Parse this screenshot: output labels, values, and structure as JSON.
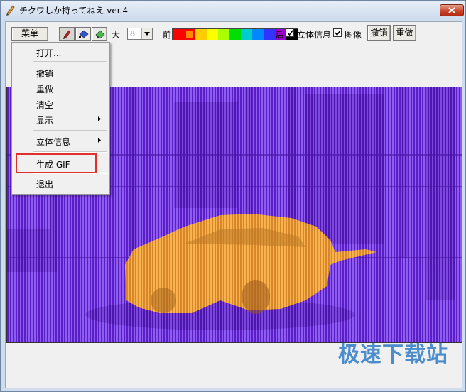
{
  "window": {
    "title": "チクワしか持ってねえ ver.4"
  },
  "toolbar": {
    "menu_label": "菜单",
    "size_label": "大",
    "size_value": "8",
    "front_label": "前",
    "back_label": "后",
    "stereo_label": "立体信息",
    "image_label": "图像",
    "undo_label": "撤销",
    "redo_label": "重做",
    "stereo_checked": true,
    "image_checked": true,
    "palette": [
      "#ff0000",
      "#ff8800",
      "#ffcc00",
      "#ffff00",
      "#aaff00",
      "#00dd00",
      "#00cccc",
      "#0088ff",
      "#3333ff",
      "#9900cc",
      "#000000"
    ]
  },
  "menu": {
    "items": [
      {
        "label": "打开..."
      },
      {
        "label": "撤销"
      },
      {
        "label": "重做"
      },
      {
        "label": "清空"
      },
      {
        "label": "显示",
        "submenu": true
      },
      {
        "label": "立体信息",
        "submenu": true
      },
      {
        "label": "生成 GIF",
        "highlighted": true
      },
      {
        "label": "退出"
      }
    ]
  },
  "canvas": {
    "description_colors": {
      "background": "#6b2fd8",
      "subject": "#f5a23c"
    }
  },
  "watermark": {
    "text": "极速下载站"
  }
}
